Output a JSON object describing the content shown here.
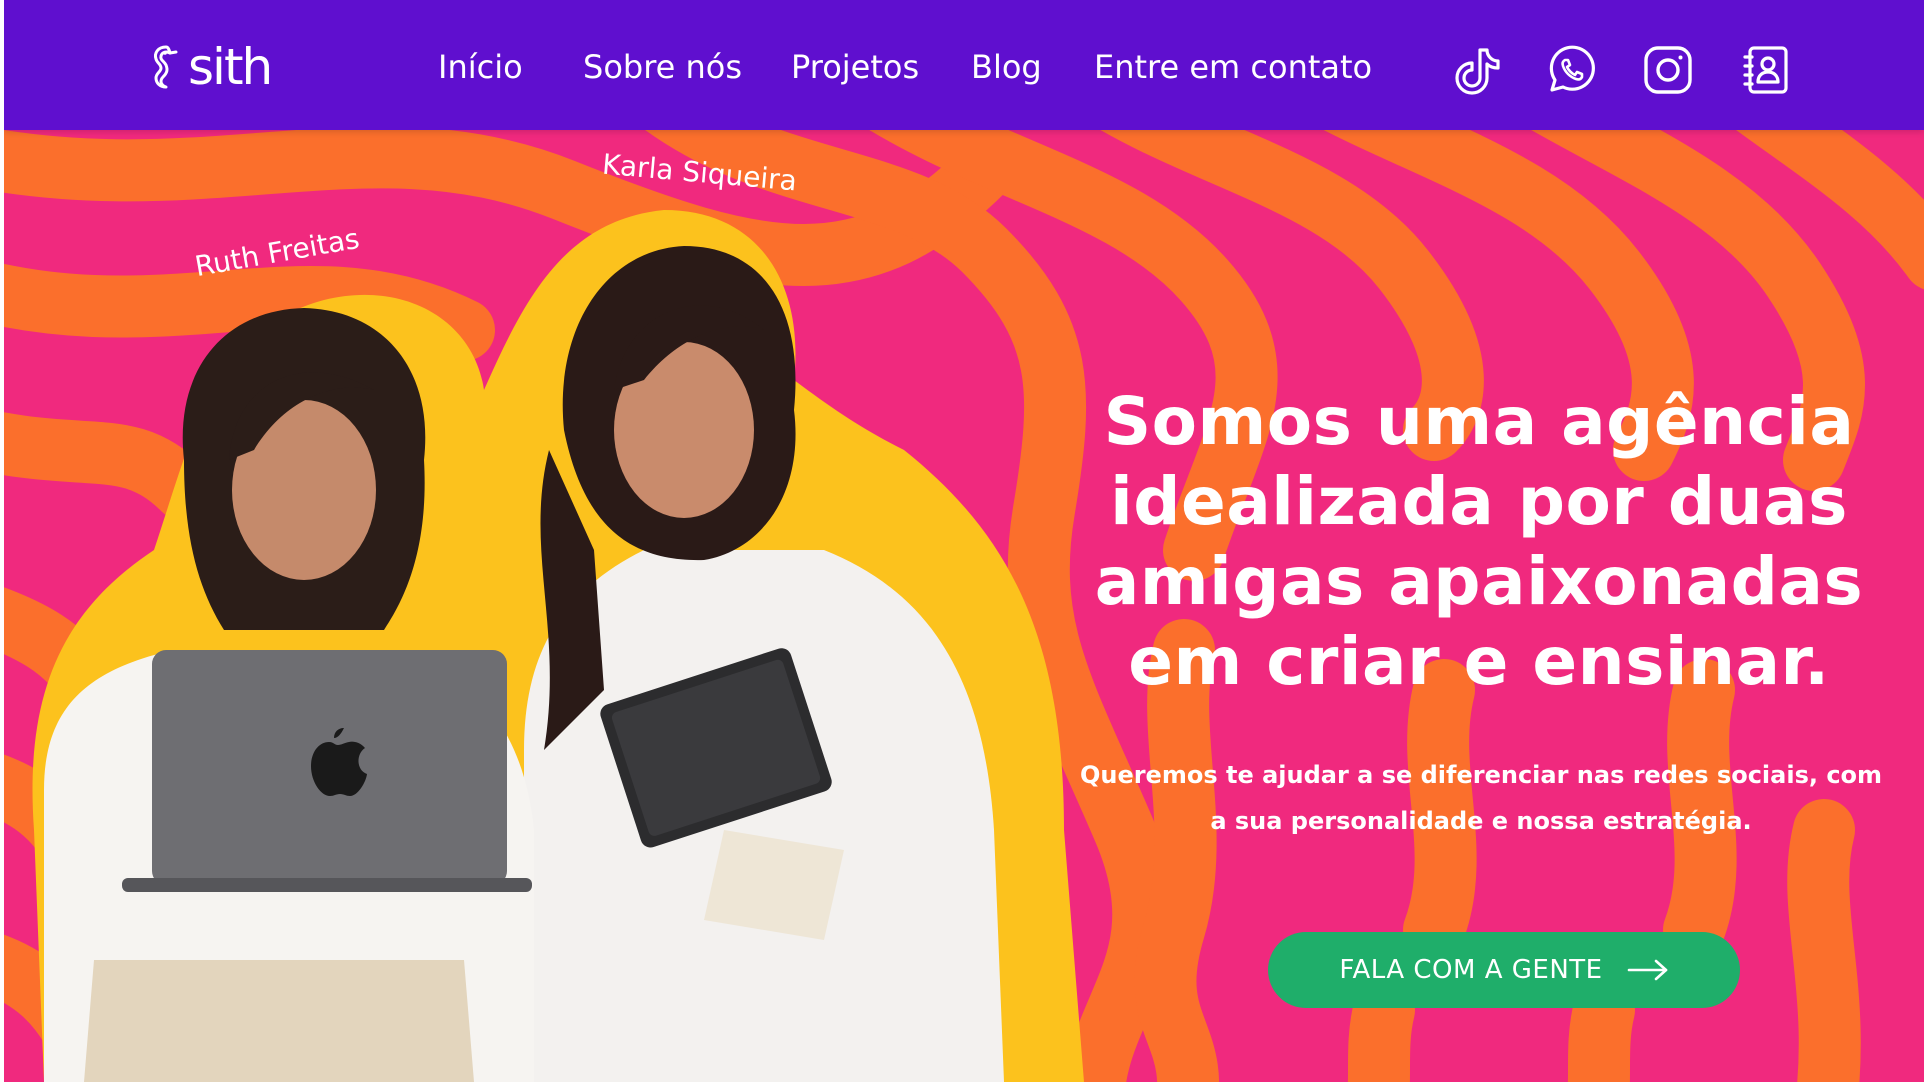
{
  "brand": {
    "logo_text": "sith"
  },
  "nav": {
    "items": [
      {
        "label": "Início"
      },
      {
        "label": "Sobre nós"
      },
      {
        "label": "Projetos"
      },
      {
        "label": "Blog"
      },
      {
        "label": "Entre em contato"
      }
    ]
  },
  "social": [
    {
      "icon": "tiktok-icon"
    },
    {
      "icon": "whatsapp-icon"
    },
    {
      "icon": "instagram-icon"
    },
    {
      "icon": "contact-book-icon"
    }
  ],
  "hero": {
    "names": {
      "left": "Ruth  Freitas",
      "right": "Karla Siqueira"
    },
    "headline": "Somos uma agência idealizada por duas amigas apaixonadas em criar e ensinar.",
    "subtext": "Queremos te ajudar a se diferenciar nas redes sociais, com a sua personalidade e nossa estratégia.",
    "cta_label": "FALA COM A GENTE"
  },
  "colors": {
    "header": "#5f0fcf",
    "hero_pink": "#f0297e",
    "hero_orange": "#fb6f2c",
    "cta": "#1fae6a"
  }
}
